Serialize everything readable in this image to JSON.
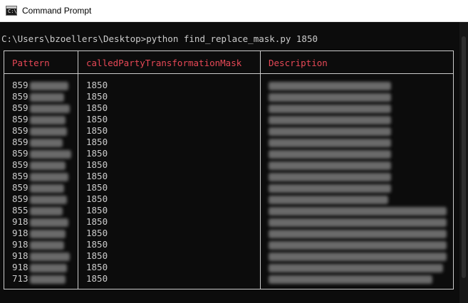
{
  "window": {
    "title": "Command Prompt",
    "icon": "terminal-icon",
    "icon_glyph": "C:\\"
  },
  "console": {
    "command_line": "C:\\Users\\bzoellers\\Desktop>python find_replace_mask.py 1850",
    "text_color": "#cccccc",
    "header_color": "#e74856",
    "background": "#0c0c0c"
  },
  "table": {
    "headers": [
      "Pattern",
      "calledPartyTransformationMask",
      "Description"
    ],
    "rows": [
      {
        "pattern_prefix": "859",
        "mask": "1850"
      },
      {
        "pattern_prefix": "859",
        "mask": "1850"
      },
      {
        "pattern_prefix": "859",
        "mask": "1850"
      },
      {
        "pattern_prefix": "859",
        "mask": "1850"
      },
      {
        "pattern_prefix": "859",
        "mask": "1850"
      },
      {
        "pattern_prefix": "859",
        "mask": "1850"
      },
      {
        "pattern_prefix": "859",
        "mask": "1850"
      },
      {
        "pattern_prefix": "859",
        "mask": "1850"
      },
      {
        "pattern_prefix": "859",
        "mask": "1850"
      },
      {
        "pattern_prefix": "859",
        "mask": "1850"
      },
      {
        "pattern_prefix": "859",
        "mask": "1850"
      },
      {
        "pattern_prefix": "855",
        "mask": "1850"
      },
      {
        "pattern_prefix": "918",
        "mask": "1850"
      },
      {
        "pattern_prefix": "918",
        "mask": "1850"
      },
      {
        "pattern_prefix": "918",
        "mask": "1850"
      },
      {
        "pattern_prefix": "918",
        "mask": "1850"
      },
      {
        "pattern_prefix": "918",
        "mask": "1850"
      },
      {
        "pattern_prefix": "713",
        "mask": "1850"
      }
    ]
  }
}
